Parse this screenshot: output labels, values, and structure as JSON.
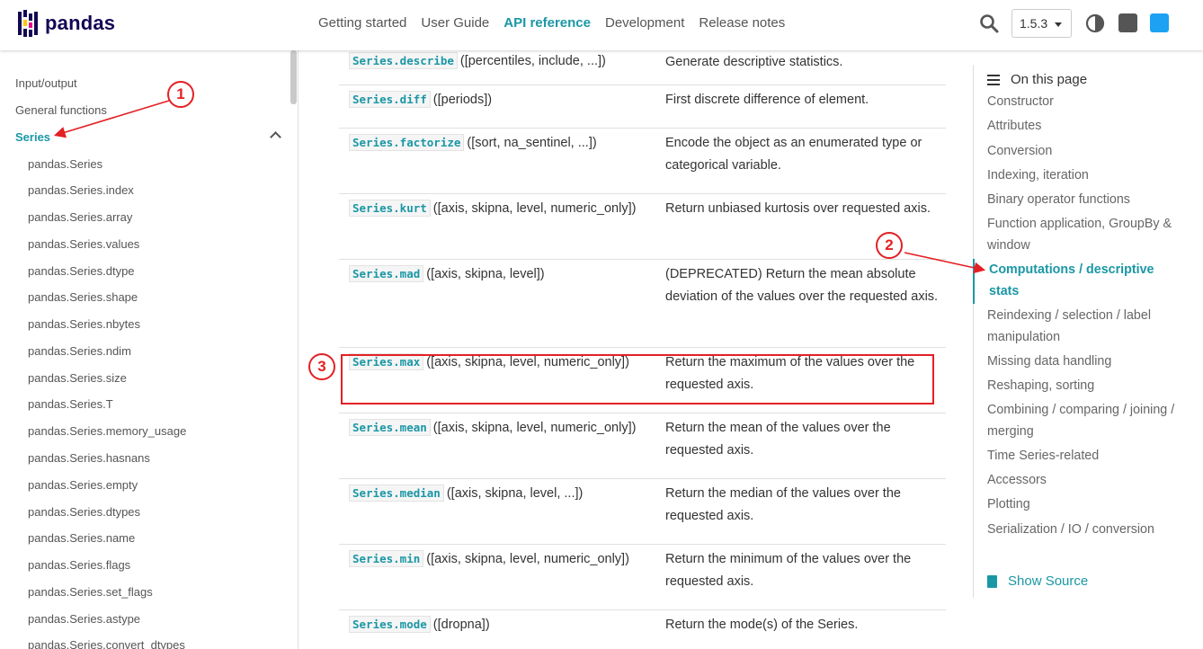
{
  "brand": {
    "name": "pandas"
  },
  "nav": {
    "links": [
      "Getting started",
      "User Guide",
      "API reference",
      "Development",
      "Release notes"
    ],
    "active": "API reference",
    "version": "1.5.3"
  },
  "left_nav": {
    "sections": [
      "Input/output",
      "General functions",
      "Series"
    ],
    "active": "Series",
    "sub_items": [
      "pandas.Series",
      "pandas.Series.index",
      "pandas.Series.array",
      "pandas.Series.values",
      "pandas.Series.dtype",
      "pandas.Series.shape",
      "pandas.Series.nbytes",
      "pandas.Series.ndim",
      "pandas.Series.size",
      "pandas.Series.T",
      "pandas.Series.memory_usage",
      "pandas.Series.hasnans",
      "pandas.Series.empty",
      "pandas.Series.dtypes",
      "pandas.Series.name",
      "pandas.Series.flags",
      "pandas.Series.set_flags",
      "pandas.Series.astype",
      "pandas.Series.convert_dtypes"
    ]
  },
  "table": {
    "rows": [
      {
        "name": "Series.describe",
        "args": "([percentiles, include, ...])",
        "desc": "Generate descriptive statistics."
      },
      {
        "name": "Series.diff",
        "args": "([periods])",
        "desc": "First discrete difference of element."
      },
      {
        "name": "Series.factorize",
        "args": "([sort, na_sentinel, ...])",
        "desc": "Encode the object as an enumerated type or categorical variable."
      },
      {
        "name": "Series.kurt",
        "args": "([axis, skipna, level, numeric_only])",
        "desc": "Return unbiased kurtosis over requested axis."
      },
      {
        "name": "Series.mad",
        "args": "([axis, skipna, level])",
        "desc": "(DEPRECATED) Return the mean absolute deviation of the values over the requested axis."
      },
      {
        "name": "Series.max",
        "args": "([axis, skipna, level, numeric_only])",
        "desc": "Return the maximum of the values over the requested axis."
      },
      {
        "name": "Series.mean",
        "args": "([axis, skipna, level, numeric_only])",
        "desc": "Return the mean of the values over the requested axis."
      },
      {
        "name": "Series.median",
        "args": "([axis, skipna, level, ...])",
        "desc": "Return the median of the values over the requested axis."
      },
      {
        "name": "Series.min",
        "args": "([axis, skipna, level, numeric_only])",
        "desc": "Return the minimum of the values over the requested axis."
      },
      {
        "name": "Series.mode",
        "args": "([dropna])",
        "desc": "Return the mode(s) of the Series."
      }
    ]
  },
  "toc": {
    "title": "On this page",
    "items": [
      "Constructor",
      "Attributes",
      "Conversion",
      "Indexing, iteration",
      "Binary operator functions",
      "Function application, GroupBy & window",
      "Computations / descriptive stats",
      "Reindexing / selection / label manipulation",
      "Missing data handling",
      "Reshaping, sorting",
      "Combining / comparing / joining / merging",
      "Time Series-related",
      "Accessors",
      "Plotting",
      "Serialization / IO / conversion"
    ],
    "active": "Computations / descriptive stats",
    "show_source": "Show Source"
  },
  "annotations": {
    "labels": [
      "1",
      "2",
      "3"
    ],
    "color": "#e32024"
  },
  "colors": {
    "accent": "#1a97a5",
    "brand": "#130754"
  }
}
